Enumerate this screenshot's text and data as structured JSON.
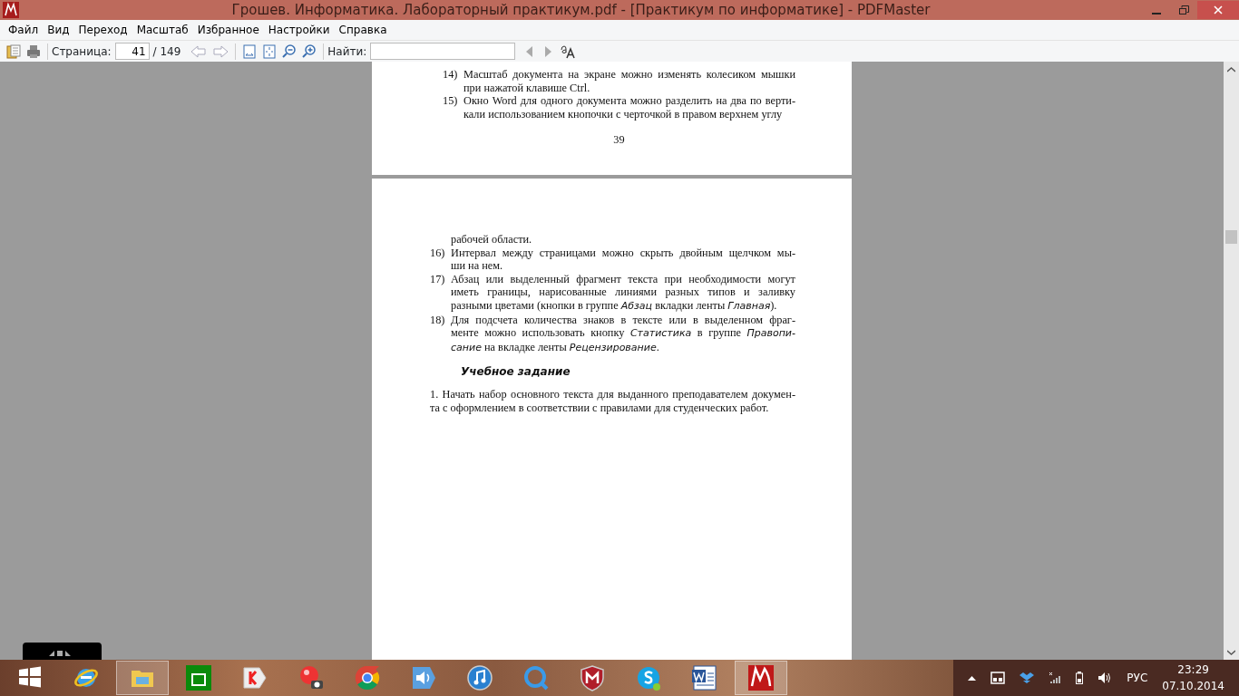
{
  "window": {
    "title": "Грошев. Информатика. Лабораторный практикум.pdf - [Практикум по информатике] - PDFMaster"
  },
  "menu": [
    "Файл",
    "Вид",
    "Переход",
    "Масштаб",
    "Избранное",
    "Настройки",
    "Справка"
  ],
  "toolbar": {
    "page_label": "Страница:",
    "page_value": "41",
    "page_total": "/ 149",
    "find_label": "Найти:"
  },
  "pages": [
    {
      "items": [
        {
          "num": "14)",
          "lines": [
            "Масштаб документа на экране можно изменять колесиком мышки",
            "при нажатой клавише Ctrl."
          ]
        },
        {
          "num": "15)",
          "lines": [
            "Окно Word для одного документа можно разделить на два по верти-",
            "кали использованием кнопочки с черточкой в правом верхнем углу"
          ]
        }
      ],
      "page_number": "39"
    },
    {
      "continuation": "рабочей области.",
      "items": [
        {
          "num": "16)",
          "lines": [
            "Интервал между страницами можно скрыть двойным щелчком мы-",
            "ши на нем."
          ]
        },
        {
          "num": "17)",
          "lines": [
            "Абзац или выделенный фрагмент текста при необходимости могут",
            "иметь границы, нарисованные линиями разных типов и заливку",
            "разными цветами (кнопки в группе *Абзац* вкладки ленты *Главная*)."
          ]
        },
        {
          "num": "18)",
          "lines": [
            "Для подсчета количества знаков в тексте или в выделенном фраг-",
            "менте можно использовать кнопку *Статистика* в группе *Правопи-*",
            "*сание* на вкладке ленты *Рецензирование*."
          ]
        }
      ],
      "heading": "Учебное задание",
      "paragraph": [
        "1. Начать набор основного текста для выданного преподавателем докумен-",
        "та с оформлением в соответствии с правилами для студенческих работ."
      ]
    }
  ],
  "taskbar": {
    "apps": [
      {
        "kind": "windows",
        "selected": false
      },
      {
        "kind": "ie",
        "selected": false
      },
      {
        "kind": "folder",
        "selected": true
      },
      {
        "kind": "store",
        "selected": false
      },
      {
        "kind": "yandex",
        "selected": false
      },
      {
        "kind": "camera",
        "selected": false
      },
      {
        "kind": "chrome",
        "selected": false
      },
      {
        "kind": "audio",
        "selected": false
      },
      {
        "kind": "music",
        "selected": false
      },
      {
        "kind": "quicktime",
        "selected": false
      },
      {
        "kind": "shield",
        "selected": false
      },
      {
        "kind": "skype",
        "selected": false
      },
      {
        "kind": "word",
        "selected": false
      },
      {
        "kind": "pdf",
        "selected": true
      }
    ],
    "language": "РУС",
    "time": "23:29",
    "date": "07.10.2014"
  }
}
